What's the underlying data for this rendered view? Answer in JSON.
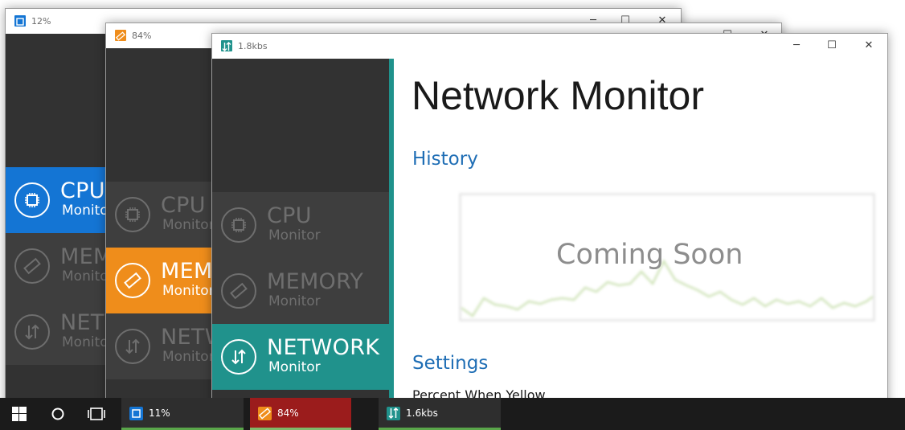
{
  "windows": {
    "cpu": {
      "title": "12%",
      "accent": "#1475d4",
      "items": [
        {
          "l1": "CPU",
          "l2": "Monitor"
        },
        {
          "l1": "MEMORY",
          "l2": "Monitor"
        },
        {
          "l1": "NETWORK",
          "l2": "Monitor"
        }
      ]
    },
    "memory": {
      "title": "84%",
      "accent": "#ef8d1b",
      "items": [
        {
          "l1": "CPU",
          "l2": "Monitor"
        },
        {
          "l1": "MEMORY",
          "l2": "Monitor"
        },
        {
          "l1": "NETWORK",
          "l2": "Monitor"
        }
      ]
    },
    "network": {
      "title": "1.8kbs",
      "accent": "#20928c",
      "items": [
        {
          "l1": "CPU",
          "l2": "Monitor"
        },
        {
          "l1": "MEMORY",
          "l2": "Monitor"
        },
        {
          "l1": "NETWORK",
          "l2": "Monitor"
        }
      ],
      "heading": "Network Monitor",
      "history_label": "History",
      "coming_soon": "Coming Soon",
      "settings_label": "Settings",
      "percent_when_yellow": "Percent When Yellow"
    }
  },
  "window_controls": {
    "minimize": "─",
    "maximize": "☐",
    "close": "✕"
  },
  "taskbar": {
    "cpu_label": "11%",
    "memory_label": "84%",
    "network_label": "1.6kbs",
    "cpu_color": "#1475d4",
    "memory_color": "#ef8d1b",
    "network_color": "#20928c",
    "memory_bg": "#9b1c1c"
  }
}
